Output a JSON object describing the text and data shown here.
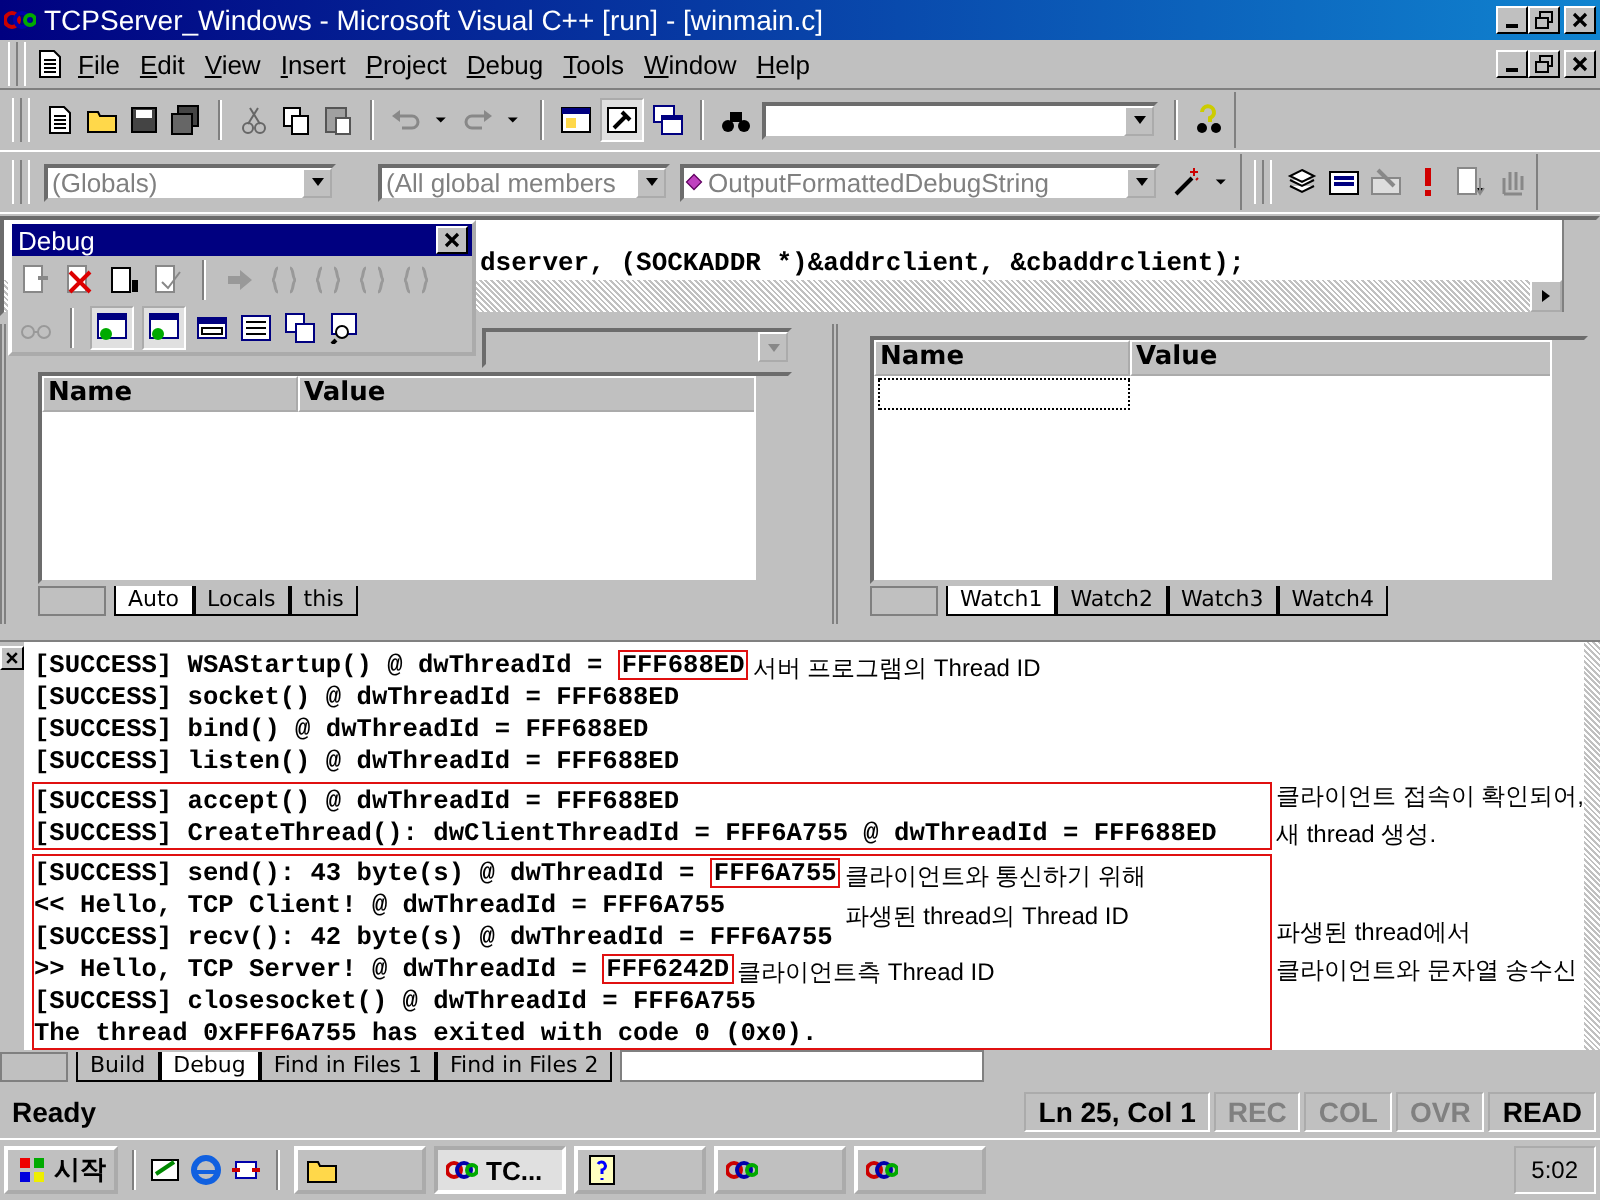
{
  "window": {
    "title": "TCPServer_Windows - Microsoft Visual C++ [run] - [winmain.c]"
  },
  "menu": [
    {
      "label": "File"
    },
    {
      "label": "Edit"
    },
    {
      "label": "View"
    },
    {
      "label": "Insert"
    },
    {
      "label": "Project"
    },
    {
      "label": "Debug"
    },
    {
      "label": "Tools"
    },
    {
      "label": "Window"
    },
    {
      "label": "Help"
    }
  ],
  "wizard_bar": {
    "class_combo": "(Globals)",
    "members_combo": "(All global members",
    "function_combo": "OutputFormattedDebugString"
  },
  "debug_toolbar": {
    "title": "Debug"
  },
  "editor": {
    "code_line": "dserver, (SOCKADDR *)&addrclient, &cbaddrclient);"
  },
  "variables": {
    "columns": [
      "Name",
      "Value"
    ],
    "tabs": [
      {
        "label": "Auto",
        "selected": true
      },
      {
        "label": "Locals",
        "selected": false
      },
      {
        "label": "this",
        "selected": false
      }
    ]
  },
  "watch": {
    "columns": [
      "Name",
      "Value"
    ],
    "tabs": [
      {
        "label": "Watch1",
        "selected": true
      },
      {
        "label": "Watch2",
        "selected": false
      },
      {
        "label": "Watch3",
        "selected": false
      },
      {
        "label": "Watch4",
        "selected": false
      }
    ]
  },
  "output": {
    "groups": [
      {
        "boxed": false,
        "lines": [
          {
            "text": "[SUCCESS] WSAStartup() @ dwThreadId = ",
            "highlight": "FFF688ED",
            "note": [
              "서버 프로그램의 Thread ID"
            ]
          },
          {
            "text": "[SUCCESS] socket() @ dwThreadId = FFF688ED"
          },
          {
            "text": "[SUCCESS] bind() @ dwThreadId = FFF688ED"
          },
          {
            "text": "[SUCCESS] listen() @ dwThreadId = FFF688ED"
          }
        ]
      },
      {
        "boxed": true,
        "note": [
          "클라이언트 접속이 확인되어,",
          "새 thread 생성."
        ],
        "lines": [
          {
            "text": "[SUCCESS] accept() @ dwThreadId = FFF688ED"
          },
          {
            "text": "[SUCCESS] CreateThread(): dwClientThreadId = FFF6A755 @ dwThreadId = FFF688ED"
          }
        ]
      },
      {
        "boxed": true,
        "note": [
          "파생된 thread에서",
          "클라이언트와 문자열 송수신"
        ],
        "lines": [
          {
            "text": "[SUCCESS] send(): 43 byte(s) @ dwThreadId = ",
            "highlight": "FFF6A755",
            "note": [
              "클라이언트와 통신하기 위해",
              "파생된 thread의 Thread ID"
            ]
          },
          {
            "text": "<< Hello, TCP Client! @ dwThreadId = FFF6A755"
          },
          {
            "text": "[SUCCESS] recv(): 42 byte(s) @ dwThreadId = FFF6A755"
          },
          {
            "text": ">> Hello, TCP Server! @ dwThreadId = ",
            "highlight": "FFF6242D",
            "note": [
              "클라이언트측 Thread ID"
            ]
          },
          {
            "text": "[SUCCESS] closesocket() @ dwThreadId = FFF6A755"
          },
          {
            "text": "The thread 0xFFF6A755 has exited with code 0 (0x0)."
          }
        ]
      }
    ],
    "tabs": [
      {
        "label": "Build",
        "selected": false
      },
      {
        "label": "Debug",
        "selected": true
      },
      {
        "label": "Find in Files 1",
        "selected": false
      },
      {
        "label": "Find in Files 2",
        "selected": false
      }
    ]
  },
  "status_bar": {
    "message": "Ready",
    "position": "Ln 25, Col 1",
    "indicators": [
      {
        "label": "REC",
        "active": false
      },
      {
        "label": "COL",
        "active": false
      },
      {
        "label": "OVR",
        "active": false
      },
      {
        "label": "READ",
        "active": true
      }
    ]
  },
  "taskbar": {
    "start": "시작",
    "tasks": [
      {
        "kind": "folder",
        "selected": false
      },
      {
        "kind": "app",
        "label": "TC...",
        "selected": true
      },
      {
        "kind": "help",
        "selected": false
      },
      {
        "kind": "app",
        "selected": false
      },
      {
        "kind": "app",
        "selected": false
      }
    ],
    "clock": "5:02"
  }
}
